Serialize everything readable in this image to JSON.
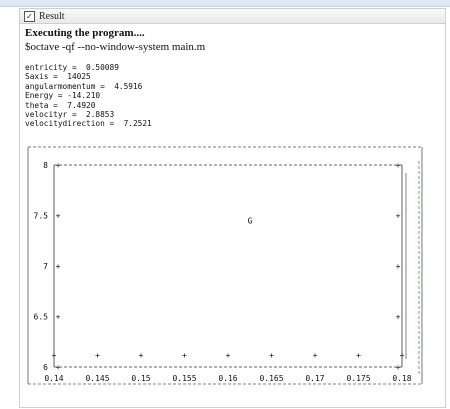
{
  "result_tab": {
    "label": "Result",
    "icon": "checkbox-icon"
  },
  "heading": "Executing the program....",
  "command": "$octave -qf --no-window-system main.m",
  "output_lines": [
    "entricity =  0.50089",
    "Saxis =  14025",
    "angularmomentum =  4.5916",
    "Energy = -14.210",
    "theta =  7.4920",
    "velocityr =  2.8853",
    "velocitydirection =  7.2521"
  ],
  "chart_data": {
    "type": "scatter",
    "title": "",
    "xlabel": "",
    "ylabel": "",
    "xlim": [
      0.14,
      0.18
    ],
    "ylim": [
      6,
      8
    ],
    "x_ticks": [
      "0.14",
      "0.145",
      "0.15",
      "0.155",
      "0.16",
      "0.165",
      "0.17",
      "0.175",
      "0.18"
    ],
    "y_ticks": [
      "8",
      "7.5",
      "7",
      "6.5",
      "6"
    ],
    "annotation": {
      "text": "G",
      "x": 0.16,
      "y": 7.45
    }
  }
}
